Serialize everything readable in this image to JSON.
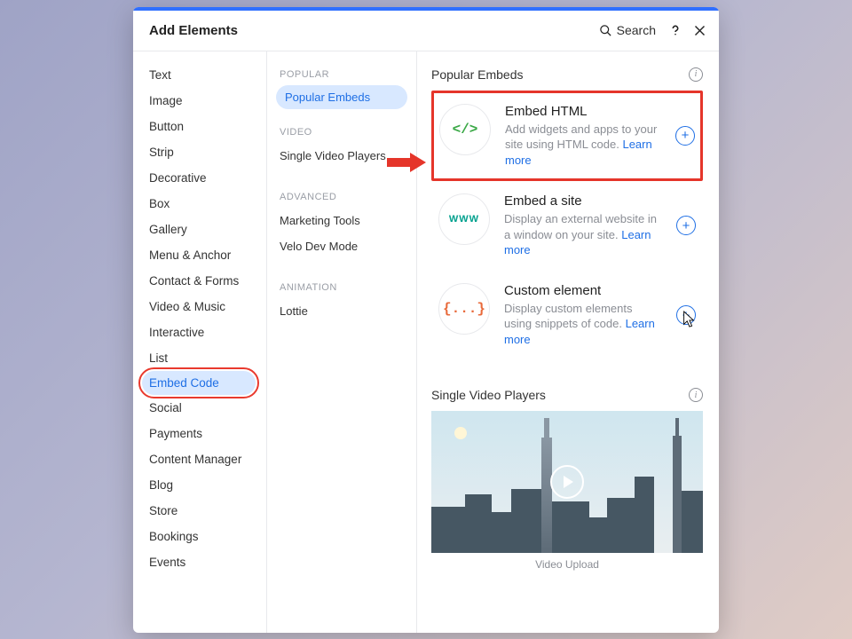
{
  "header": {
    "title": "Add Elements",
    "search": "Search"
  },
  "categories": [
    "Text",
    "Image",
    "Button",
    "Strip",
    "Decorative",
    "Box",
    "Gallery",
    "Menu & Anchor",
    "Contact & Forms",
    "Video & Music",
    "Interactive",
    "List",
    "Embed Code",
    "Social",
    "Payments",
    "Content Manager",
    "Blog",
    "Store",
    "Bookings",
    "Events"
  ],
  "categories_selected": 12,
  "middle": {
    "sections": [
      {
        "heading": "POPULAR",
        "items": [
          "Popular Embeds"
        ],
        "selected": 0
      },
      {
        "heading": "VIDEO",
        "items": [
          "Single Video Players"
        ]
      },
      {
        "heading": "ADVANCED",
        "items": [
          "Marketing Tools",
          "Velo Dev Mode"
        ]
      },
      {
        "heading": "ANIMATION",
        "items": [
          "Lottie"
        ]
      }
    ]
  },
  "main": {
    "embeds_heading": "Popular Embeds",
    "cards": [
      {
        "icon_label": "</>",
        "title": "Embed HTML",
        "desc": "Add widgets and apps to your site using HTML code. ",
        "learn": "Learn more"
      },
      {
        "icon_label": "WWW",
        "title": "Embed a site",
        "desc": "Display an external website in a window on your site. ",
        "learn": "Learn more"
      },
      {
        "icon_label": "{...}",
        "title": "Custom element",
        "desc": "Display custom elements using snippets of code. ",
        "learn": "Learn more"
      }
    ],
    "video_heading": "Single Video Players",
    "video_caption": "Video Upload"
  }
}
